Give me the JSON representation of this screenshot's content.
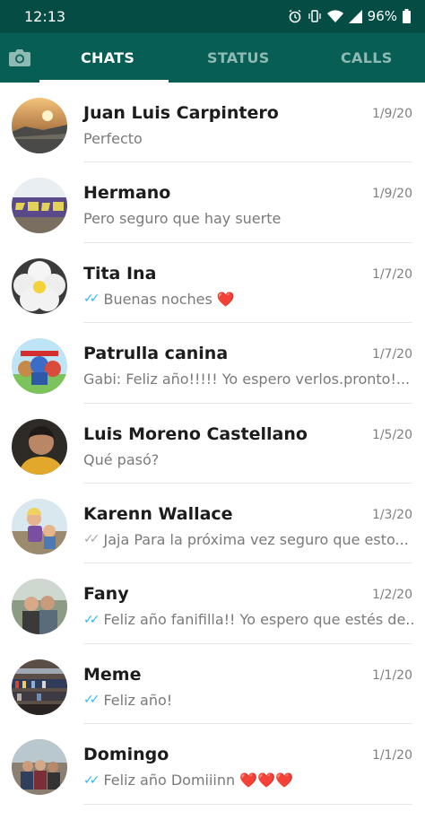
{
  "status_bar": {
    "time": "12:13",
    "battery": "96%"
  },
  "tabs": {
    "chats": "CHATS",
    "status": "STATUS",
    "calls": "CALLS"
  },
  "colors": {
    "header": "#075e54",
    "status_bar": "#054d44",
    "read_ticks": "#34b7f1"
  },
  "chats": [
    {
      "name": "Juan Luis Carpintero",
      "date": "1/9/20",
      "preview": "Perfecto",
      "read": false
    },
    {
      "name": "Hermano",
      "date": "1/9/20",
      "preview": "Pero seguro que hay suerte",
      "read": false
    },
    {
      "name": "Tita Ina",
      "date": "1/7/20",
      "preview": "Buenas noches ❤️",
      "read": true
    },
    {
      "name": "Patrulla canina",
      "date": "1/7/20",
      "preview": "Gabi: Feliz año!!!!! Yo espero verlos.pronto!...",
      "read": false
    },
    {
      "name": "Luis Moreno Castellano",
      "date": "1/5/20",
      "preview": "Qué pasó?",
      "read": false
    },
    {
      "name": "Karenn Wallace",
      "date": "1/3/20",
      "preview": "Jaja Para la próxima vez seguro que esto...",
      "read": true,
      "ticks_grey": true
    },
    {
      "name": "Fany",
      "date": "1/2/20",
      "preview": "Feliz año fanifilla!! Yo espero que estés de...",
      "read": true
    },
    {
      "name": "Meme",
      "date": "1/1/20",
      "preview": "Feliz año!",
      "read": true
    },
    {
      "name": "Domingo",
      "date": "1/1/20",
      "preview": "Feliz año Domiiinn ❤️❤️❤️",
      "read": true
    }
  ]
}
